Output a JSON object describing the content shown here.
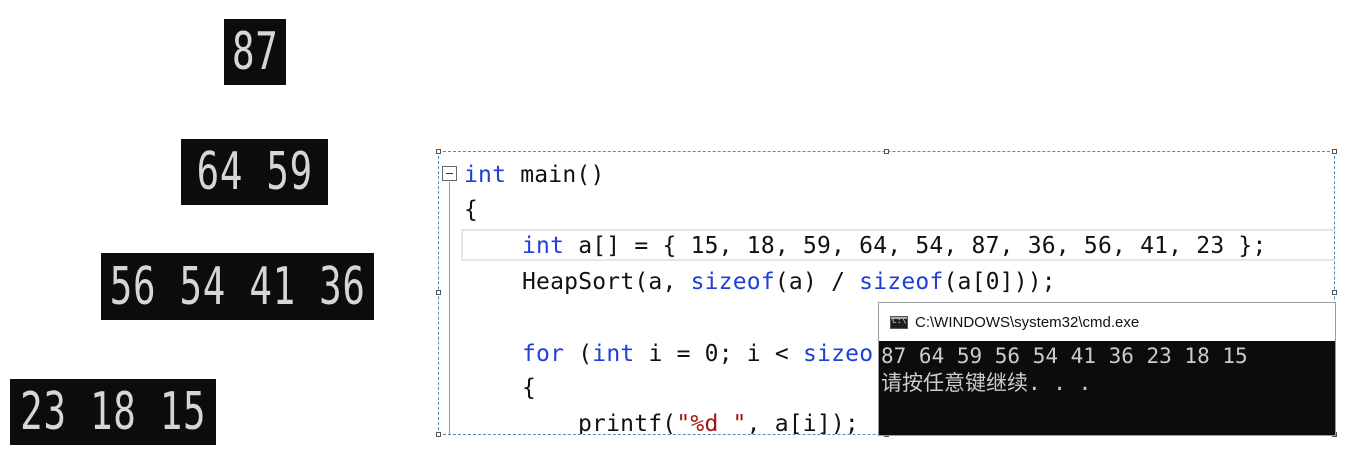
{
  "heap_levels": [
    {
      "text": "87"
    },
    {
      "text": "64 59"
    },
    {
      "text": "56 54 41 36"
    },
    {
      "text": "23 18 15"
    }
  ],
  "code_editor": {
    "lines": [
      {
        "kw": "int",
        "rest": " main()"
      },
      {
        "text": "{"
      },
      {
        "kw": "int",
        "rest": " a[] = { 15, 18, 59, 64, 54, 87, 36, 56, 41, 23 };"
      },
      {
        "call": "HeapSort(a, ",
        "kw1": "sizeof",
        "mid": "(a) / ",
        "kw2": "sizeof",
        "end": "(a[0]));"
      },
      {
        "kw": "for",
        "mid": " (",
        "kw2": "int",
        "rest": " i = 0; i < ",
        "kw3": "sizeo"
      },
      {
        "text": "{"
      },
      {
        "fn": "printf(",
        "str": "\"%d \"",
        "rest": ", a[i]);"
      }
    ]
  },
  "console": {
    "title": "C:\\WINDOWS\\system32\\cmd.exe",
    "icon": "cmd-icon",
    "output_line_1": "87 64 59 56 54 41 36 23 18 15",
    "output_line_2": "请按任意键继续. . ."
  }
}
